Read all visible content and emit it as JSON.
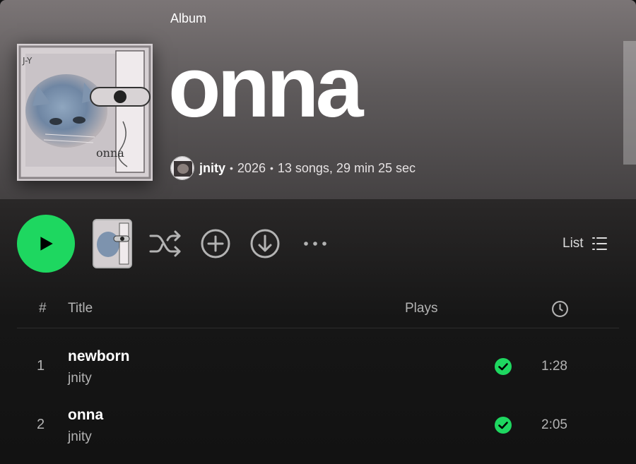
{
  "header": {
    "type_label": "Album",
    "title": "onna",
    "artist": "jnity",
    "year": "2026",
    "summary": "13 songs, 29 min 25 sec"
  },
  "controls": {
    "view_label": "List",
    "more_glyph": "• • •"
  },
  "tracklist": {
    "col_number": "#",
    "col_title": "Title",
    "col_plays": "Plays",
    "tracks": [
      {
        "number": "1",
        "title": "newborn",
        "artist": "jnity",
        "duration": "1:28",
        "downloaded": true
      },
      {
        "number": "2",
        "title": "onna",
        "artist": "jnity",
        "duration": "2:05",
        "downloaded": true
      }
    ]
  },
  "colors": {
    "accent": "#1ed760",
    "header_top": "#7b7576",
    "background": "#121212",
    "muted_text": "#b3b3b3"
  },
  "icons": [
    "play-icon",
    "shuffle-icon",
    "add-circle-icon",
    "download-icon",
    "more-icon",
    "list-view-icon",
    "clock-icon",
    "check-circle-icon"
  ]
}
